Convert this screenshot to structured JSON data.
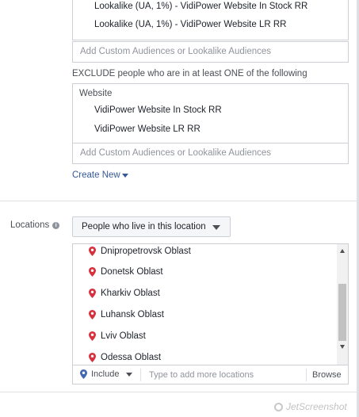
{
  "include": {
    "items": [
      "Lookalike (UA, 1%) - VidiPower Website In Stock RR",
      "Lookalike (UA, 1%) - VidiPower Website LR RR"
    ],
    "add_placeholder": "Add Custom Audiences or Lookalike Audiences"
  },
  "exclude": {
    "label": "EXCLUDE people who are in at least ONE of the following",
    "section_label": "Website",
    "items": [
      "VidiPower Website In Stock RR",
      "VidiPower Website LR RR"
    ],
    "add_placeholder": "Add Custom Audiences or Lookalike Audiences"
  },
  "create_new": "Create New",
  "locations": {
    "label": "Locations",
    "info_icon": "info-icon",
    "dropdown_value": "People who live in this location",
    "items": [
      "Dnipropetrovsk Oblast",
      "Donetsk Oblast",
      "Kharkiv Oblast",
      "Luhansk Oblast",
      "Lviv Oblast",
      "Odessa Oblast"
    ],
    "include_label": "Include",
    "type_placeholder": "Type to add more locations",
    "browse_label": "Browse",
    "pin_color": "#d8313d"
  },
  "colors": {
    "link": "#365899",
    "border": "#ccd0d5",
    "placeholder": "#90949c",
    "label": "#4b4f56"
  },
  "watermark": "JetScreenshot"
}
